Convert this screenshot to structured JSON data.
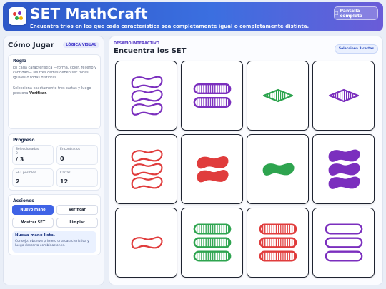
{
  "header": {
    "title": "SET MathCraft",
    "subtitle": "Encuentra tríos en los que cada característica sea completamente igual o completamente distinta.",
    "fullscreen_label": "Pantalla completa",
    "fullscreen_icon": "□"
  },
  "sidebar": {
    "title": "Cómo Jugar",
    "badge": "LÓGICA VISUAL",
    "rule": {
      "title": "Regla",
      "text": "En cada característica —forma, color, relleno y cantidad— las tres cartas deben ser todas iguales o todas distintas.",
      "text2_prefix": "Selecciona exactamente tres cartas y luego presiona ",
      "text2_bold": "Verificar",
      "text2_suffix": "."
    },
    "progress": {
      "title": "Progreso",
      "selected_label": "Seleccionadas",
      "selected_value": "0",
      "selected_total": "/ 3",
      "found_label": "Encontrados",
      "found_value": "0",
      "possible_label": "SET posibles",
      "possible_value": "2",
      "cards_label": "Cartas",
      "cards_value": "12"
    },
    "actions": {
      "title": "Acciones",
      "new_hand": "Nuevo mano",
      "verify": "Verificar",
      "show_set": "Mostrar SET",
      "clear": "Limpiar",
      "notice_title": "Nueva mano lista.",
      "notice_body": "Consejo: observa primero una característica y luego descarta combinaciones."
    }
  },
  "main": {
    "kicker": "DESAFÍO INTERACTIVO",
    "title": "Encuentra los SET",
    "select_hint": "Selecciona 3 cartas"
  },
  "colors": {
    "purple": "#7b2fbe",
    "red": "#e03c3c",
    "green": "#2ea44f"
  },
  "cards": [
    {
      "shape": "squiggle",
      "color": "purple",
      "fill": "open",
      "count": 3
    },
    {
      "shape": "oval",
      "color": "purple",
      "fill": "striped",
      "count": 2
    },
    {
      "shape": "diamond",
      "color": "green",
      "fill": "striped",
      "count": 1
    },
    {
      "shape": "diamond",
      "color": "purple",
      "fill": "striped",
      "count": 1
    },
    {
      "shape": "squiggle",
      "color": "red",
      "fill": "open",
      "count": 3
    },
    {
      "shape": "squiggle",
      "color": "red",
      "fill": "solid",
      "count": 2
    },
    {
      "shape": "squiggle",
      "color": "green",
      "fill": "solid",
      "count": 1
    },
    {
      "shape": "squiggle",
      "color": "purple",
      "fill": "solid",
      "count": 3
    },
    {
      "shape": "squiggle",
      "color": "red",
      "fill": "open",
      "count": 1
    },
    {
      "shape": "oval",
      "color": "green",
      "fill": "striped",
      "count": 3
    },
    {
      "shape": "oval",
      "color": "red",
      "fill": "striped",
      "count": 3
    },
    {
      "shape": "oval",
      "color": "purple",
      "fill": "open",
      "count": 3
    }
  ]
}
